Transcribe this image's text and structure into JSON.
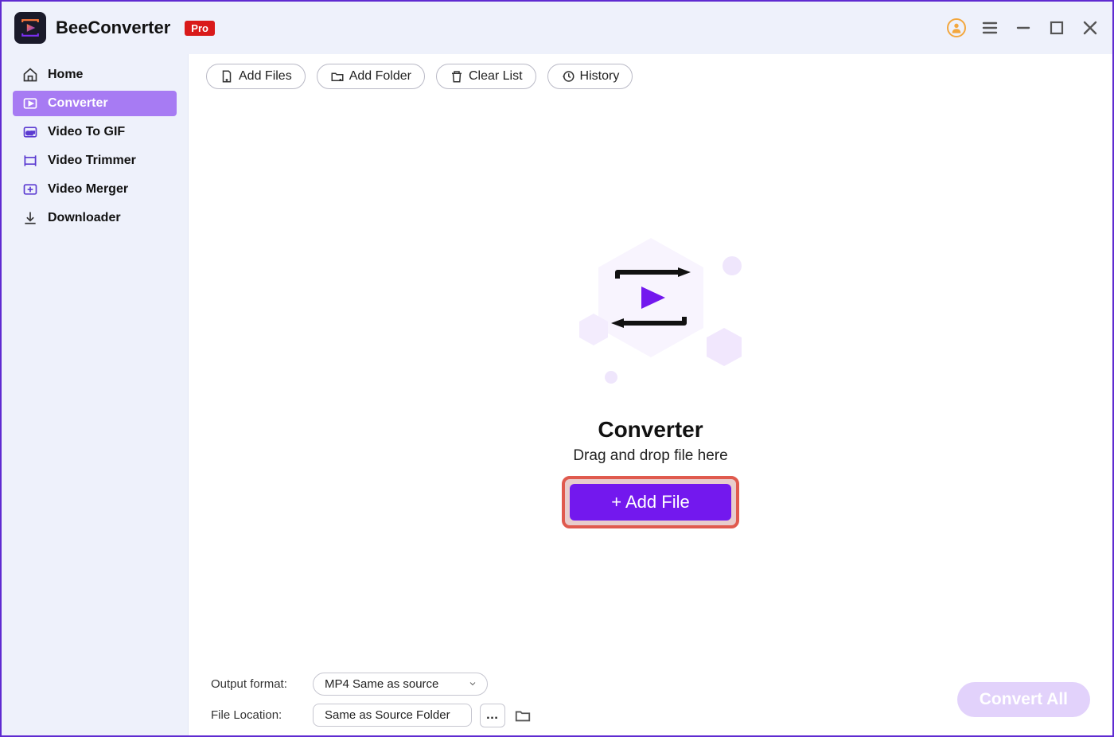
{
  "app": {
    "name": "BeeConverter",
    "badge": "Pro"
  },
  "sidebar": {
    "items": [
      {
        "label": "Home",
        "icon": "home-icon",
        "active": false
      },
      {
        "label": "Converter",
        "icon": "converter-icon",
        "active": true
      },
      {
        "label": "Video To GIF",
        "icon": "gif-icon",
        "active": false
      },
      {
        "label": "Video Trimmer",
        "icon": "trimmer-icon",
        "active": false
      },
      {
        "label": "Video Merger",
        "icon": "merger-icon",
        "active": false
      },
      {
        "label": "Downloader",
        "icon": "download-icon",
        "active": false
      }
    ]
  },
  "toolbar": {
    "add_files": "Add Files",
    "add_folder": "Add Folder",
    "clear_list": "Clear List",
    "history": "History"
  },
  "hero": {
    "title": "Converter",
    "subtitle": "Drag and drop file here",
    "cta": "+ Add File"
  },
  "footer": {
    "output_label": "Output format:",
    "output_value": "MP4 Same as source",
    "location_label": "File Location:",
    "location_value": "Same as Source Folder",
    "more_label": "…",
    "convert_all": "Convert All"
  }
}
